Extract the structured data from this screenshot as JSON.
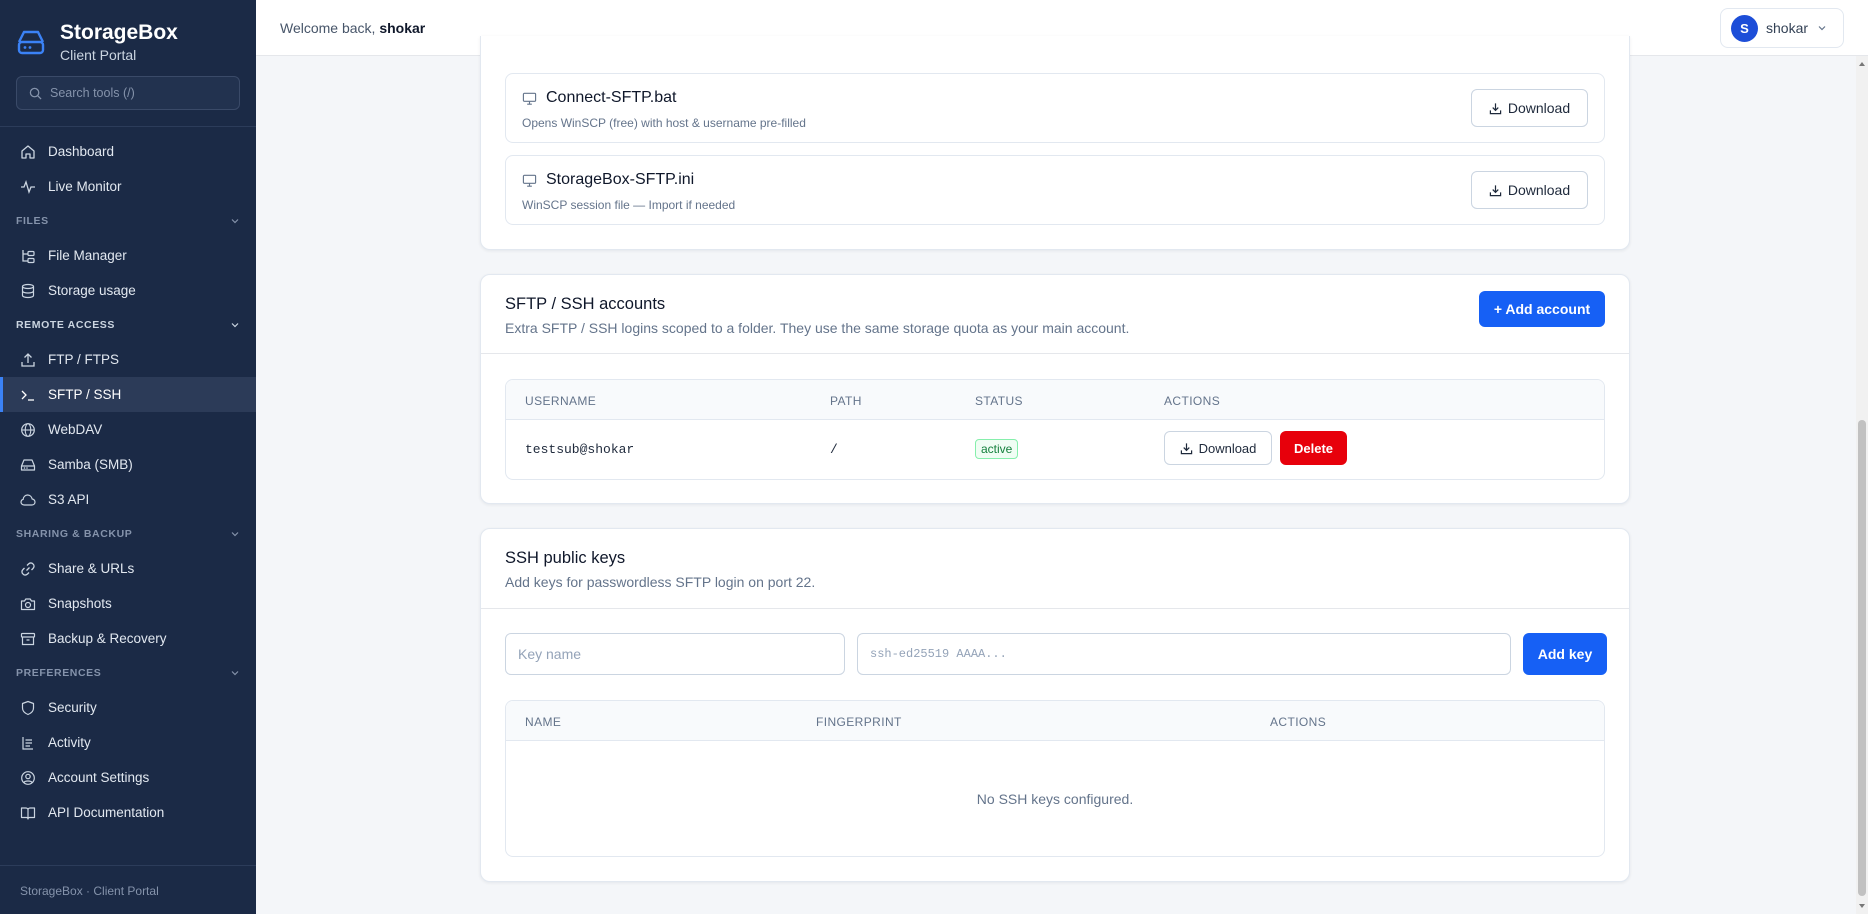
{
  "brand": {
    "title": "StorageBox",
    "subtitle": "Client Portal"
  },
  "search": {
    "placeholder": "Search tools (/)"
  },
  "nav": {
    "dashboard": "Dashboard",
    "live_monitor": "Live Monitor",
    "files_section": "FILES",
    "file_manager": "File Manager",
    "storage_usage": "Storage usage",
    "remote_section": "REMOTE ACCESS",
    "ftp": "FTP / FTPS",
    "sftp": "SFTP / SSH",
    "webdav": "WebDAV",
    "samba": "Samba (SMB)",
    "s3": "S3 API",
    "sharing_section": "SHARING & BACKUP",
    "share_urls": "Share & URLs",
    "snapshots": "Snapshots",
    "backup": "Backup & Recovery",
    "prefs_section": "PREFERENCES",
    "security": "Security",
    "activity": "Activity",
    "account_settings": "Account Settings",
    "api_docs": "API Documentation"
  },
  "sidebar_footer": "StorageBox · Client Portal",
  "header": {
    "welcome": "Welcome back,",
    "username": "shokar",
    "avatar_initial": "S",
    "user_menu_label": "shokar"
  },
  "downloads": {
    "files": [
      {
        "name": "Connect-SFTP.bat",
        "description": "Opens WinSCP (free) with host & username pre-filled",
        "button": "Download"
      },
      {
        "name": "StorageBox-SFTP.ini",
        "description": "WinSCP session file — Import if needed",
        "button": "Download"
      }
    ]
  },
  "sftp_accounts": {
    "title": "SFTP / SSH accounts",
    "subtitle": "Extra SFTP / SSH logins scoped to a folder. They use the same storage quota as your main account.",
    "add_button": "+ Add account",
    "columns": [
      "USERNAME",
      "PATH",
      "STATUS",
      "ACTIONS"
    ],
    "rows": [
      {
        "username": "testsub@shokar",
        "path": "/",
        "status": "active",
        "download": "Download",
        "delete": "Delete"
      }
    ]
  },
  "ssh_keys": {
    "title": "SSH public keys",
    "subtitle": "Add keys for passwordless SFTP login on port 22.",
    "key_name_placeholder": "Key name",
    "key_value_placeholder": "ssh-ed25519 AAAA...",
    "add_button": "Add key",
    "columns": [
      "NAME",
      "FINGERPRINT",
      "ACTIONS"
    ],
    "empty_text": "No SSH keys configured."
  },
  "colors": {
    "sidebar_bg": "#1b2a46",
    "primary": "#1660f5",
    "danger": "#e7000b",
    "success": "#15803d"
  }
}
